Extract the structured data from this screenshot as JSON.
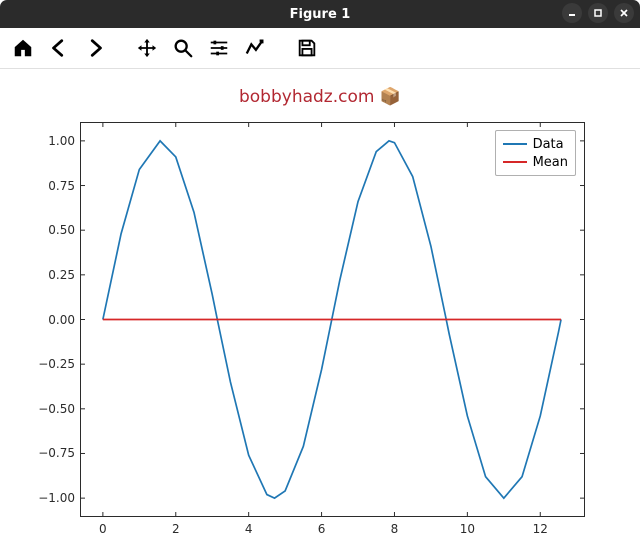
{
  "window": {
    "title": "Figure 1"
  },
  "toolbar": {
    "home": "Home",
    "back": "Back",
    "forward": "Forward",
    "pan": "Pan",
    "zoom": "Zoom",
    "configure": "Configure subplots",
    "edit": "Edit axis",
    "save": "Save"
  },
  "figure": {
    "title_text": "bobbyhadz.com",
    "title_icon": "📦"
  },
  "legend": {
    "entries": [
      {
        "label": "Data",
        "color": "#1f77b4"
      },
      {
        "label": "Mean",
        "color": "#d62728"
      }
    ]
  },
  "chart_data": {
    "type": "line",
    "title": "bobbyhadz.com",
    "xlabel": "",
    "ylabel": "",
    "xlim": [
      -0.6,
      13.2
    ],
    "ylim": [
      -1.1,
      1.1
    ],
    "xticks": [
      0,
      2,
      4,
      6,
      8,
      10,
      12
    ],
    "yticks": [
      -1.0,
      -0.75,
      -0.5,
      -0.25,
      0.0,
      0.25,
      0.5,
      0.75,
      1.0
    ],
    "series": [
      {
        "name": "Data",
        "color": "#1f77b4",
        "x": [
          0.0,
          0.5,
          1.0,
          1.57,
          2.0,
          2.5,
          3.0,
          3.14,
          3.5,
          4.0,
          4.5,
          4.71,
          5.0,
          5.5,
          6.0,
          6.28,
          6.5,
          7.0,
          7.5,
          7.85,
          8.0,
          8.5,
          9.0,
          9.42,
          9.5,
          10.0,
          10.5,
          11.0,
          11.5,
          12.0,
          12.5,
          12.57
        ],
        "y": [
          0.0,
          0.48,
          0.84,
          1.0,
          0.91,
          0.6,
          0.14,
          0.0,
          -0.35,
          -0.76,
          -0.98,
          -1.0,
          -0.96,
          -0.71,
          -0.28,
          0.0,
          0.22,
          0.66,
          0.94,
          1.0,
          0.99,
          0.8,
          0.41,
          0.0,
          -0.08,
          -0.54,
          -0.88,
          -1.0,
          -0.88,
          -0.54,
          -0.07,
          0.0
        ]
      },
      {
        "name": "Mean",
        "color": "#d62728",
        "x": [
          0.0,
          12.57
        ],
        "y": [
          0.0,
          0.0
        ]
      }
    ]
  },
  "ytick_labels": [
    "1.00",
    "0.75",
    "0.50",
    "0.25",
    "0.00",
    "−0.25",
    "−0.50",
    "−0.75",
    "−1.00"
  ],
  "xtick_labels": [
    "0",
    "2",
    "4",
    "6",
    "8",
    "10",
    "12"
  ]
}
